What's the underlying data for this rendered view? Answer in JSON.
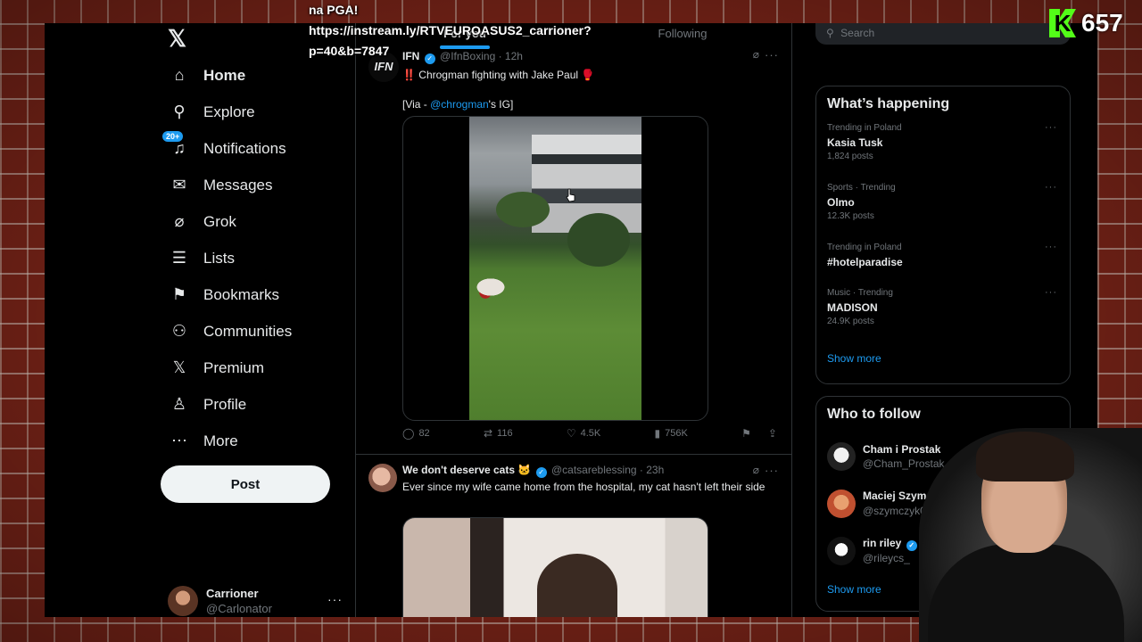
{
  "overlay": {
    "line1": "na PGA!",
    "line2": "https://instream.ly/RTVEUROASUS2_carrioner?",
    "line3": "p=40&b=7847"
  },
  "kick": {
    "letter": "K",
    "count": "657",
    "color": "#53fc18"
  },
  "nav": {
    "logo": "𝕏",
    "items": [
      {
        "label": "Home",
        "icon": "home-icon",
        "glyph": "⌂"
      },
      {
        "label": "Explore",
        "icon": "search-icon",
        "glyph": "⚲"
      },
      {
        "label": "Notifications",
        "icon": "bell-icon",
        "glyph": "♫",
        "badge": "20+"
      },
      {
        "label": "Messages",
        "icon": "mail-icon",
        "glyph": "✉"
      },
      {
        "label": "Grok",
        "icon": "grok-icon",
        "glyph": "⌀"
      },
      {
        "label": "Lists",
        "icon": "list-icon",
        "glyph": "☰"
      },
      {
        "label": "Bookmarks",
        "icon": "bookmark-icon",
        "glyph": "⚑"
      },
      {
        "label": "Communities",
        "icon": "communities-icon",
        "glyph": "⚇"
      },
      {
        "label": "Premium",
        "icon": "x-premium-icon",
        "glyph": "𝕏"
      },
      {
        "label": "Profile",
        "icon": "profile-icon",
        "glyph": "♙"
      },
      {
        "label": "More",
        "icon": "more-circle-icon",
        "glyph": "⋯"
      }
    ],
    "post_label": "Post"
  },
  "account": {
    "name": "Carrioner",
    "handle": "@Carlonator",
    "dots": "···"
  },
  "timeline": {
    "tabs": [
      "For you",
      "Following"
    ],
    "tweet1": {
      "avatar_text": "IFN",
      "name": "IFN",
      "handle": "@IfnBoxing",
      "time": "· 12h",
      "text": "‼️ Chrogman fighting with Jake Paul 🥊",
      "via_prefix": "[Via - ",
      "via_link": "@chrogman",
      "via_suffix": "'s IG]",
      "replies": "82",
      "reposts": "116",
      "likes": "4.5K",
      "views": "756K"
    },
    "tweet2": {
      "name": "We don't deserve cats 🐱",
      "handle": "@catsareblessing",
      "time": "· 23h",
      "text": "Ever since my wife came home from the hospital, my cat hasn't left their side"
    }
  },
  "search": {
    "placeholder": "Search"
  },
  "whats_happening": {
    "title": "What’s happening",
    "trends": [
      {
        "context": "Trending in Poland",
        "name": "Kasia Tusk",
        "count": "1,824 posts"
      },
      {
        "context": "Sports · Trending",
        "name": "Olmo",
        "count": "12.3K posts"
      },
      {
        "context": "Trending in Poland",
        "name": "#hotelparadise",
        "count": ""
      },
      {
        "context": "Music · Trending",
        "name": "MADISON",
        "count": "24.9K posts"
      }
    ],
    "show_more": "Show more"
  },
  "who_to_follow": {
    "title": "Who to follow",
    "accounts": [
      {
        "name": "Cham i Prostak",
        "handle": "@Cham_Prostak",
        "verified": false
      },
      {
        "name": "Maciej Szymczyk",
        "handle": "@szymczyk06",
        "verified": true
      },
      {
        "name": "rin riley",
        "handle": "@rileycs_",
        "verified": true
      }
    ],
    "show_more": "Show more"
  },
  "colors": {
    "accent": "#1d9bf0",
    "background": "#000000",
    "brick": "#7a2418"
  }
}
